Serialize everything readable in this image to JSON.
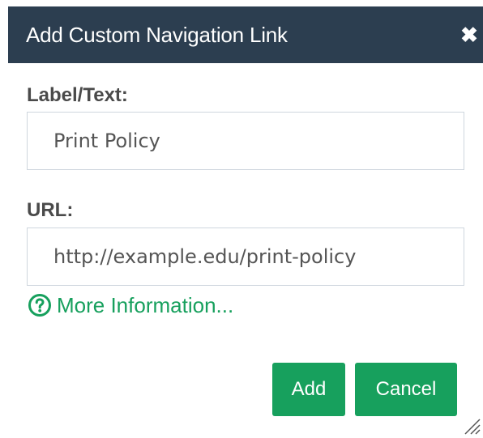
{
  "dialog": {
    "title": "Add Custom Navigation Link",
    "close_icon": "close-icon"
  },
  "form": {
    "label_field": {
      "label": "Label/Text:",
      "value": "Print Policy"
    },
    "url_field": {
      "label": "URL:",
      "value": "http://example.edu/print-policy"
    },
    "more_info": {
      "text": "More Information...",
      "icon": "help-circle-icon"
    }
  },
  "buttons": {
    "add_label": "Add",
    "cancel_label": "Cancel"
  },
  "colors": {
    "titlebar": "#2c3e50",
    "accent": "#17a05d",
    "label_text": "#4a4a4a",
    "input_border": "#cfd6de"
  }
}
